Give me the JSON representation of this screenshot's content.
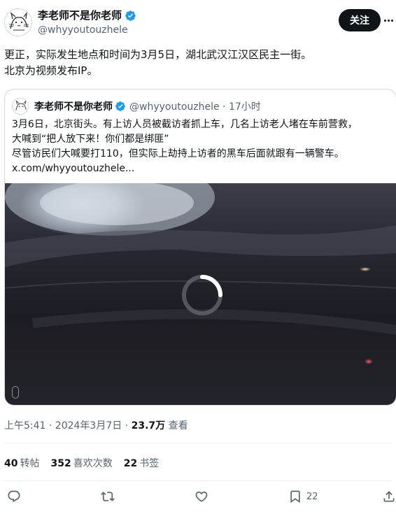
{
  "author": {
    "name": "李老师不是你老师",
    "handle": "@whyyoutouzhele"
  },
  "follow_label": "关注",
  "tweet": {
    "lines": [
      "更正，实际发生地点和时间为3月5日，湖北武汉江汉区民主一街。",
      "北京为视频发布IP。"
    ]
  },
  "quote": {
    "name": "李老师不是你老师",
    "handle_time": "@whyyoutouzhele · 17小时",
    "lines": [
      "3月6日，北京街头。有上访人员被截访者抓上车，几名上访老人堵在车前营救，",
      "大喊到“把人放下来！你们都是绑匪”",
      "尽管访民们大喊要打110，但实际上劫持上访者的黑车后面就跟有一辆警车。",
      "x.com/whyyoutouzhele..."
    ]
  },
  "meta": {
    "time": "上午5:41 · 2024年3月7日 · ",
    "views_count": "23.7万",
    "views_label": " 查看"
  },
  "stats": {
    "reposts_count": "40",
    "reposts_label": "转帖",
    "quotes_count": "352",
    "quotes_label": "喜欢次数",
    "bookmarks_count": "22",
    "bookmarks_label": "书签"
  },
  "actions": {
    "bookmark_count": "22"
  },
  "colors": {
    "verified": "#1d9bf0",
    "text": "#0f1419",
    "secondary": "#536471"
  }
}
